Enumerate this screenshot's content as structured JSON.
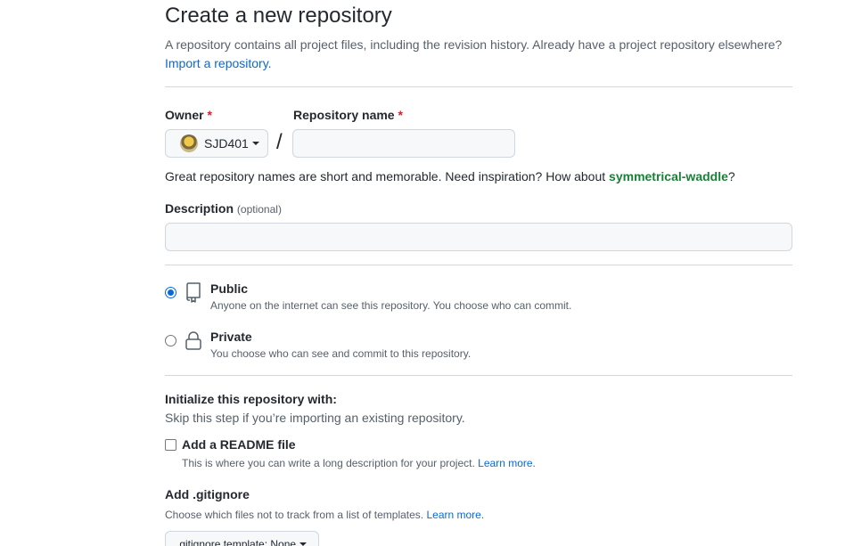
{
  "header": {
    "title": "Create a new repository",
    "intro_text": "A repository contains all project files, including the revision history. Already have a project repository elsewhere?",
    "import_link": "Import a repository."
  },
  "owner": {
    "label": "Owner",
    "required_mark": "*",
    "value": "SJD401",
    "icon": "avatar"
  },
  "separator": "/",
  "repository": {
    "label": "Repository name",
    "required_mark": "*",
    "value": "",
    "placeholder": ""
  },
  "name_hint": {
    "text": "Great repository names are short and memorable. Need inspiration? How about",
    "suggestion": "symmetrical-waddle",
    "end": "?"
  },
  "description": {
    "label": "Description",
    "optional": "(optional)",
    "value": "",
    "placeholder": ""
  },
  "visibility": {
    "public": {
      "title": "Public",
      "desc": "Anyone on the internet can see this repository. You choose who can commit.",
      "icon": "repo-icon",
      "checked": true
    },
    "private": {
      "title": "Private",
      "desc": "You choose who can see and commit to this repository.",
      "icon": "lock-icon",
      "checked": false
    }
  },
  "initialize": {
    "title": "Initialize this repository with:",
    "subtitle": "Skip this step if you’re importing an existing repository.",
    "readme": {
      "label": "Add a README file",
      "desc": "This is where you can write a long description for your project.",
      "link": "Learn more.",
      "checked": false
    }
  },
  "gitignore": {
    "title": "Add .gitignore",
    "desc": "Choose which files not to track from a list of templates.",
    "link": "Learn more.",
    "select_label": ".gitignore template: None"
  },
  "colors": {
    "link": "#0969da",
    "suggestion": "#1a7f37",
    "required": "#cf222e"
  }
}
